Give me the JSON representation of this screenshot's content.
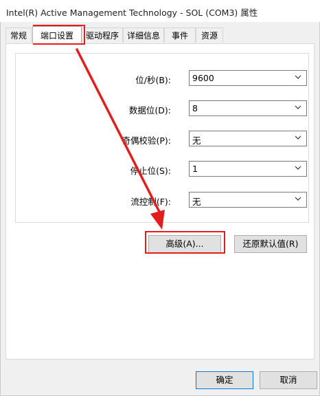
{
  "window": {
    "title": "Intel(R) Active Management Technology - SOL (COM3) 属性"
  },
  "tabs": [
    {
      "label": "常规"
    },
    {
      "label": "端口设置",
      "active": true
    },
    {
      "label": "驱动程序"
    },
    {
      "label": "详细信息"
    },
    {
      "label": "事件"
    },
    {
      "label": "资源"
    }
  ],
  "port_settings": {
    "rows": [
      {
        "label": "位/秒(B):",
        "value": "9600"
      },
      {
        "label": "数据位(D):",
        "value": "8"
      },
      {
        "label": "奇偶校验(P):",
        "value": "无"
      },
      {
        "label": "停止位(S):",
        "value": "1"
      },
      {
        "label": "流控制(F):",
        "value": "无"
      }
    ],
    "advanced_label": "高级(A)...",
    "restore_label": "还原默认值(R)"
  },
  "footer": {
    "ok_label": "确定",
    "cancel_label": "取消"
  },
  "colors": {
    "highlight": "#e31c1c",
    "arrow": "#e31c1c"
  }
}
